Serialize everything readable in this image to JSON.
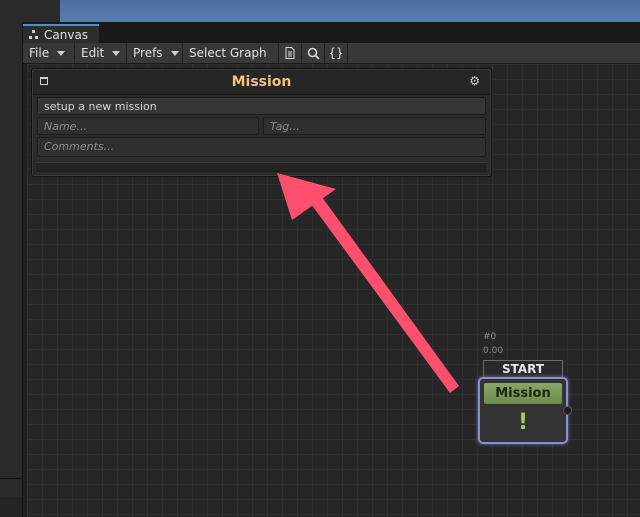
{
  "window": {
    "tab_title": "Canvas",
    "tab_icon": "hierarchy-icon"
  },
  "toolbar": {
    "menus": [
      {
        "label": "File"
      },
      {
        "label": "Edit"
      },
      {
        "label": "Prefs"
      }
    ],
    "select_graph": "Select Graph",
    "icons": [
      "document-icon",
      "search-icon",
      "braces-icon"
    ],
    "braces_glyph": "{}"
  },
  "panel": {
    "title": "Mission",
    "description_value": "setup a new mission",
    "name_placeholder": "Name...",
    "tag_placeholder": "Tag...",
    "comments_placeholder": "Comments...",
    "title_color": "#f2c27c"
  },
  "annotation": {
    "arrow_color": "#ff4f6e"
  },
  "node": {
    "id": "#0",
    "time": "0.00",
    "start_label": "START",
    "title": "Mission",
    "status_glyph": "!",
    "header_color": "#7d9c58",
    "border_color": "#8f8fc9"
  }
}
